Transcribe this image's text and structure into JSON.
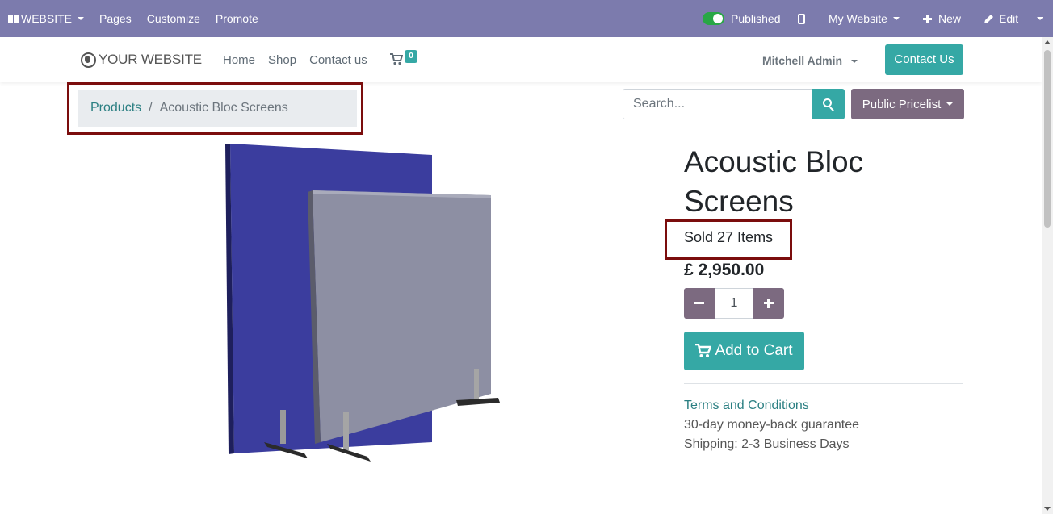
{
  "adminbar": {
    "website_label": "WEBSITE",
    "pages": "Pages",
    "customize": "Customize",
    "promote": "Promote",
    "published": "Published",
    "my_website": "My Website",
    "new": "New",
    "edit": "Edit"
  },
  "header": {
    "logo_text": "YOUR WEBSITE",
    "nav": [
      "Home",
      "Shop",
      "Contact us"
    ],
    "cart_count": "0",
    "user": "Mitchell Admin",
    "contact_button": "Contact Us"
  },
  "breadcrumb": {
    "parent": "Products",
    "separator": "/",
    "current": "Acoustic Bloc Screens"
  },
  "search": {
    "placeholder": "Search..."
  },
  "pricelist": "Public Pricelist",
  "product": {
    "title": "Acoustic Bloc Screens",
    "sold": "Sold 27 Items",
    "price": "£ 2,950.00",
    "quantity": "1",
    "add_to_cart": "Add to Cart",
    "terms": "Terms and Conditions",
    "guarantee": "30-day money-back guarantee",
    "shipping": "Shipping: 2-3 Business Days"
  },
  "colors": {
    "adminbar": "#7c7bad",
    "accent": "#35a8a5",
    "secondary": "#7c6a80",
    "highlight_border": "#7b0d0d"
  }
}
